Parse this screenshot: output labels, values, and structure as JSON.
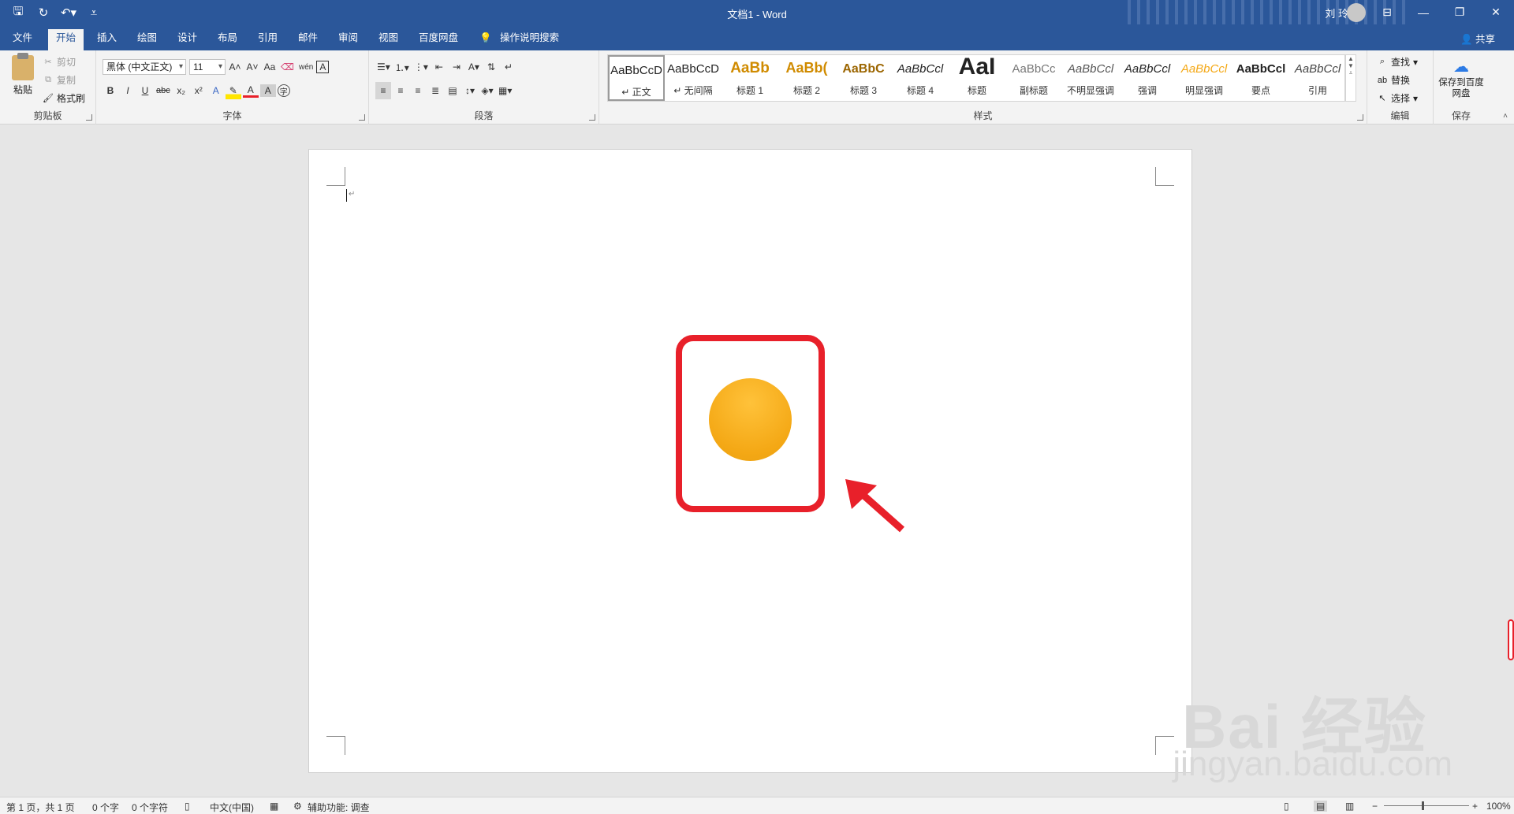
{
  "window": {
    "title": "文档1  -  Word",
    "user": "刘 玲"
  },
  "tabs": [
    "文件",
    "开始",
    "插入",
    "绘图",
    "设计",
    "布局",
    "引用",
    "邮件",
    "审阅",
    "视图",
    "百度网盘"
  ],
  "active_tab": "开始",
  "tell_me": "操作说明搜索",
  "share": "共享",
  "clipboard": {
    "paste": "粘贴",
    "cut": "剪切",
    "copy": "复制",
    "format_painter": "格式刷",
    "label": "剪贴板"
  },
  "font": {
    "name": "黑体 (中文正文)",
    "size": "11",
    "label": "字体",
    "aa": "Aa",
    "wen": "wén",
    "bold": "B",
    "italic": "I",
    "underline": "U",
    "strike": "abc",
    "sub": "x₂",
    "sup": "x²",
    "grow": "A˄",
    "shrink": "A˅",
    "effects": "A",
    "color_a": "A",
    "char_shade": "A",
    "enclose": "字"
  },
  "paragraph": {
    "label": "段落"
  },
  "styles": {
    "label": "样式",
    "items": [
      {
        "sample": "AaBbCcD",
        "name": "↵ 正文"
      },
      {
        "sample": "AaBbCcD",
        "name": "↵ 无间隔"
      },
      {
        "sample": "AaBb",
        "name": "标题 1"
      },
      {
        "sample": "AaBb(",
        "name": "标题 2"
      },
      {
        "sample": "AaBbC",
        "name": "标题 3"
      },
      {
        "sample": "AaBbCcl",
        "name": "标题 4"
      },
      {
        "sample": "AaI",
        "name": "标题"
      },
      {
        "sample": "AaBbCc",
        "name": "副标题"
      },
      {
        "sample": "AaBbCcl",
        "name": "不明显强调"
      },
      {
        "sample": "AaBbCcl",
        "name": "强调"
      },
      {
        "sample": "AaBbCcl",
        "name": "明显强调"
      },
      {
        "sample": "AaBbCcl",
        "name": "要点"
      },
      {
        "sample": "AaBbCcl",
        "name": "引用"
      }
    ]
  },
  "editing": {
    "find": "查找",
    "replace": "替换",
    "select": "选择",
    "label": "编辑"
  },
  "save_group": {
    "button": "保存到百度网盘",
    "label": "保存"
  },
  "status": {
    "page": "第 1 页，共 1 页",
    "words": "0 个字",
    "chars": "0 个字符",
    "lang": "中文(中国)",
    "access": "辅助功能: 调查",
    "zoom": "100%"
  },
  "watermark": {
    "brand": "Bai 经验",
    "url": "jingyan.baidu.com"
  },
  "colors": {
    "accent": "#2b579a",
    "callout": "#e8202a",
    "circle": "#f4a815"
  }
}
